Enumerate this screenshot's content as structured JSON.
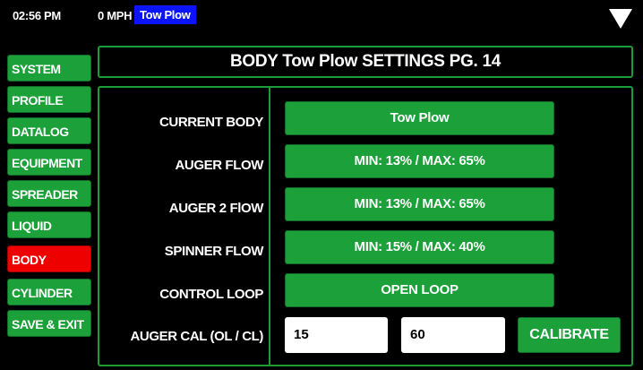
{
  "status": {
    "time": "02:56 PM",
    "speed": "0 MPH",
    "profile_badge": "Tow Plow",
    "menu_icon": "triangle-down-icon"
  },
  "sidebar": {
    "items": [
      {
        "label": "SYSTEM"
      },
      {
        "label": "PROFILE"
      },
      {
        "label": "DATALOG"
      },
      {
        "label": "EQUIPMENT"
      },
      {
        "label": "SPREADER"
      },
      {
        "label": "LIQUID"
      },
      {
        "label": "BODY",
        "active": true
      },
      {
        "label": "CYLINDER"
      },
      {
        "label": "SAVE & EXIT"
      }
    ]
  },
  "header": {
    "title": "BODY Tow Plow SETTINGS PG. 14"
  },
  "settings": {
    "current_body": {
      "label": "CURRENT BODY",
      "value": "Tow Plow"
    },
    "auger_flow": {
      "label": "AUGER FLOW",
      "value": "MIN: 13% / MAX: 65%"
    },
    "auger2_flow": {
      "label": "AUGER 2 FlOW",
      "value": "MIN: 13% / MAX: 65%"
    },
    "spinner_flow": {
      "label": "SPINNER FLOW",
      "value": "MIN: 15% / MAX: 40%"
    },
    "control_loop": {
      "label": "CONTROL LOOP",
      "value": "OPEN LOOP"
    },
    "auger_cal": {
      "label": "AUGER CAL (OL / CL)",
      "ol_value": "15",
      "cl_value": "60",
      "calibrate_label": "CALIBRATE"
    }
  },
  "colors": {
    "button_green": "#1ca03a",
    "active_red": "#ee0000",
    "border_green": "#1c9c38",
    "badge_blue": "#0a14ff",
    "background": "#000000"
  }
}
